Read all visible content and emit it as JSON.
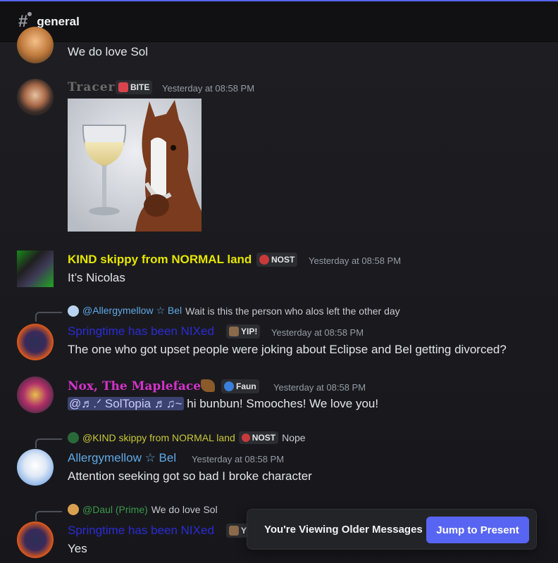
{
  "channel": {
    "name": "general"
  },
  "messages": [
    {
      "text": "We do love Sol"
    },
    {
      "author": "Tracer",
      "tag": "BITE",
      "time": "Yesterday at 08:58 PM"
    },
    {
      "author": "KIND skippy from NORMAL land",
      "tag": "NOST",
      "time": "Yesterday at 08:58 PM",
      "text": "It’s Nicolas"
    },
    {
      "reply": {
        "name": "@Allergymellow ☆ Bel",
        "text": "Wait is this the person who alos left the other day"
      },
      "author": "Springtime has been NIXed",
      "tag": "YIP!",
      "time": "Yesterday at 08:58 PM",
      "text": "The one who got upset people were joking about Eclipse and Bel getting divorced?"
    },
    {
      "author": "Nox, The Mapleface",
      "tag": "Faun",
      "time": "Yesterday at 08:58 PM",
      "mention": "@♬.ᐟ SolTopia ♬♫~",
      "text": "hi bunbun! Smooches! We love you!"
    },
    {
      "reply": {
        "name": "@KIND skippy from NORMAL land",
        "tag": "NOST",
        "text": "Nope"
      },
      "author": "Allergymellow ☆ Bel",
      "time": "Yesterday at 08:58 PM",
      "text": "Attention seeking got so bad I broke character"
    },
    {
      "reply": {
        "name": "@Daul (Prime)",
        "text": "We do love Sol"
      },
      "author": "Springtime has been NIXed",
      "tag": "YIP!",
      "text": "Yes"
    }
  ],
  "toast": {
    "message": "You're Viewing Older Messages",
    "button": "Jump to Present"
  },
  "colors": {
    "accent": "#5865f2",
    "name_yellow": "#e6e600",
    "name_blue": "#2b2bd6",
    "name_magenta": "#d433c9",
    "name_lightblue": "#5fa8e6",
    "name_tracer": "#6b6b6b"
  }
}
